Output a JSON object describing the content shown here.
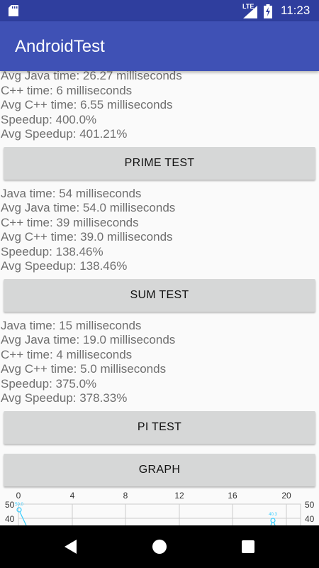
{
  "status_bar": {
    "network": "LTE",
    "time": "11:23"
  },
  "app_bar": {
    "title": "AndroidTest"
  },
  "results_top": [
    "Avg Java time: 26.27 milliseconds",
    "C++ time: 6 milliseconds",
    "Avg C++ time: 6.55 milliseconds",
    "Speedup: 400.0%",
    "Avg Speedup: 401.21%"
  ],
  "prime_test": {
    "button_label": "PRIME TEST",
    "results": [
      "Java time: 54 milliseconds",
      "Avg Java time: 54.0 milliseconds",
      "C++ time: 39 milliseconds",
      "Avg C++ time: 39.0 milliseconds",
      "Speedup: 138.46%",
      "Avg Speedup: 138.46%"
    ]
  },
  "sum_test": {
    "button_label": "SUM TEST",
    "results": [
      "Java time: 15 milliseconds",
      "Avg Java time: 19.0 milliseconds",
      "C++ time: 4 milliseconds",
      "Avg C++ time: 5.0 milliseconds",
      "Speedup: 375.0%",
      "Avg Speedup: 378.33%"
    ]
  },
  "pi_test": {
    "button_label": "PI TEST"
  },
  "graph_button": {
    "label": "GRAPH"
  },
  "graph": {
    "x_ticks": [
      "0",
      "4",
      "8",
      "12",
      "16",
      "20"
    ],
    "y_ticks_left": [
      "50",
      "40"
    ],
    "y_ticks_right": [
      "50",
      "40"
    ],
    "point_labels": [
      "50.0",
      "40.3"
    ],
    "line_color": "#33ccff"
  },
  "nav_bar": {
    "back": "back-icon",
    "home": "home-icon",
    "recents": "recents-icon"
  }
}
